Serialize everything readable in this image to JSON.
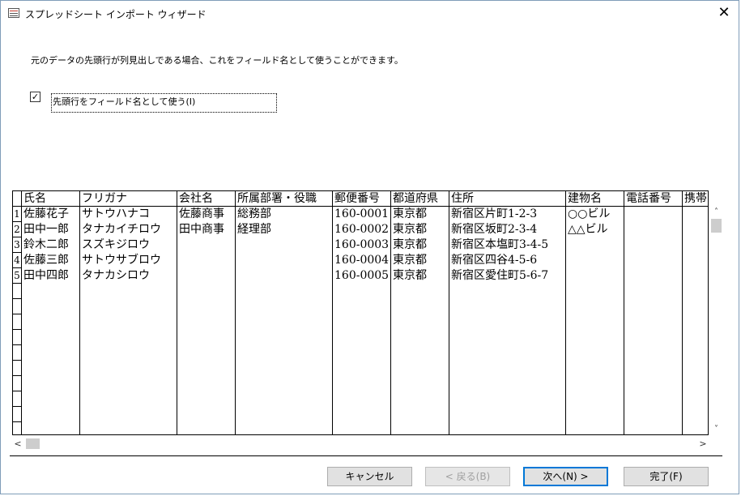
{
  "window": {
    "title": "スプレッドシート インポート ウィザード",
    "close_glyph": "✕"
  },
  "instruction": "元のデータの先頭行が列見出しである場合、これをフィールド名として使うことができます。",
  "checkbox": {
    "checked_glyph": "☑",
    "label": "先頭行をフィールド名として使う(I)",
    "checked": true
  },
  "grid": {
    "columns": [
      "氏名",
      "フリガナ",
      "会社名",
      "所属部署・役職",
      "郵便番号",
      "都道府県",
      "住所",
      "建物名",
      "電話番号",
      "携帯"
    ],
    "row_numbers": [
      "1",
      "2",
      "3",
      "4",
      "5"
    ],
    "rows": [
      [
        "佐藤花子",
        "サトウハナコ",
        "佐藤商事",
        "総務部",
        "160-0001",
        "東京都",
        "新宿区片町1-2-3",
        "○○ビル",
        "",
        ""
      ],
      [
        "田中一郎",
        "タナカイチロウ",
        "田中商事",
        "経理部",
        "160-0002",
        "東京都",
        "新宿区坂町2-3-4",
        "△△ビル",
        "",
        ""
      ],
      [
        "鈴木二郎",
        "スズキジロウ",
        "",
        "",
        "160-0003",
        "東京都",
        "新宿区本塩町3-4-5",
        "",
        "",
        ""
      ],
      [
        "佐藤三郎",
        "サトウサブロウ",
        "",
        "",
        "160-0004",
        "東京都",
        "新宿区四谷4-5-6",
        "",
        "",
        ""
      ],
      [
        "田中四郎",
        "タナカシロウ",
        "",
        "",
        "160-0005",
        "東京都",
        "新宿区愛住町5-6-7",
        "",
        "",
        ""
      ]
    ]
  },
  "scroll": {
    "up": "˄",
    "down": "˅",
    "left": "<",
    "right": ">"
  },
  "buttons": {
    "cancel": "キャンセル",
    "back": "< 戻る(B)",
    "next": "次へ(N) >",
    "finish": "完了(F)"
  }
}
